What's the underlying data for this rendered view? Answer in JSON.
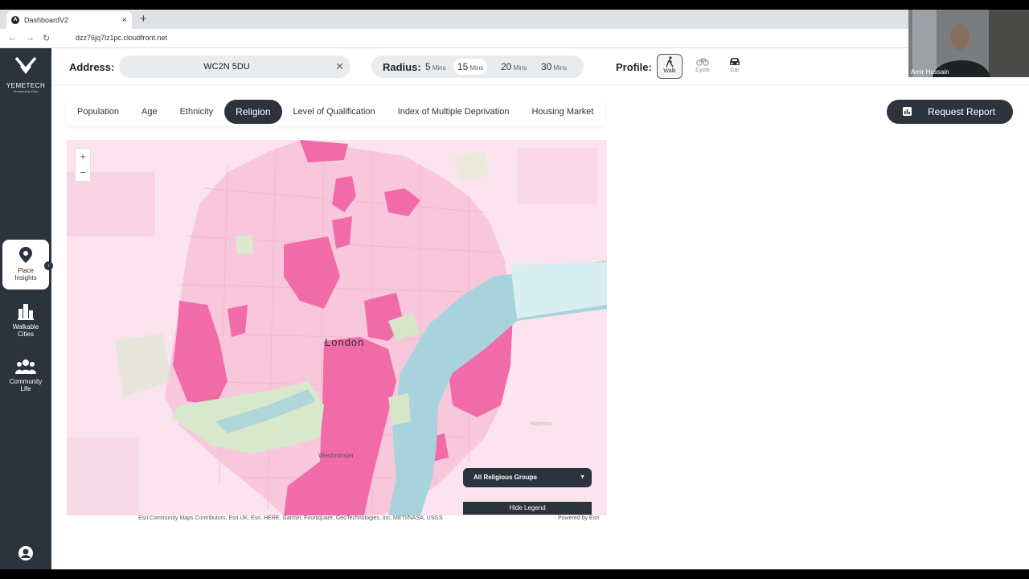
{
  "browser": {
    "tab_title": "DashboardV2",
    "url": "dzz76jq7lz1pc.cloudfront.net"
  },
  "sidebar": {
    "logo_name": "YEMETECH",
    "logo_tagline": "Humanising Data",
    "items": [
      {
        "label_line1": "Place",
        "label_line2": "Insights",
        "icon": "map-pin-icon"
      },
      {
        "label_line1": "Walkable",
        "label_line2": "Cities",
        "icon": "city-icon"
      },
      {
        "label_line1": "Community",
        "label_line2": "Life",
        "icon": "people-icon"
      }
    ]
  },
  "topbar": {
    "address_label": "Address:",
    "address_value": "WC2N 5DU",
    "radius_label": "Radius:",
    "radius_options": [
      {
        "value": "5",
        "unit": "Mins"
      },
      {
        "value": "15",
        "unit": "Mins"
      },
      {
        "value": "20",
        "unit": "Mins"
      },
      {
        "value": "30",
        "unit": "Mins"
      }
    ],
    "profile_label": "Profile:",
    "profiles": [
      "Walk",
      "Cycle",
      "Car"
    ]
  },
  "categories": [
    "Population",
    "Age",
    "Ethnicity",
    "Religion",
    "Level of Qualification",
    "Index of Multiple Deprivation",
    "Housing Market"
  ],
  "request_report_label": "Request Report",
  "map": {
    "zoom_in": "+",
    "zoom_out": "−",
    "label_london": "London",
    "label_westminster": "Westminster",
    "label_waterloo": "Waterloo",
    "dropdown_value": "All Religious Groups",
    "hide_legend": "Hide Legend",
    "attribution": "Esri Community Maps Contributors, Esri UK, Esri, HERE, Garmin, Foursquare, GeoTechnologies, Inc, METI/NASA, USGS",
    "powered_by": "Powered by Esri"
  },
  "video_overlay": {
    "name": "Amir Hussain"
  },
  "colors": {
    "sidebar": "#2b333d",
    "pink_dark": "#f06ba8",
    "pink_light": "#f8c6dc",
    "water": "#a8d3dc",
    "park": "#cfe3c4"
  }
}
